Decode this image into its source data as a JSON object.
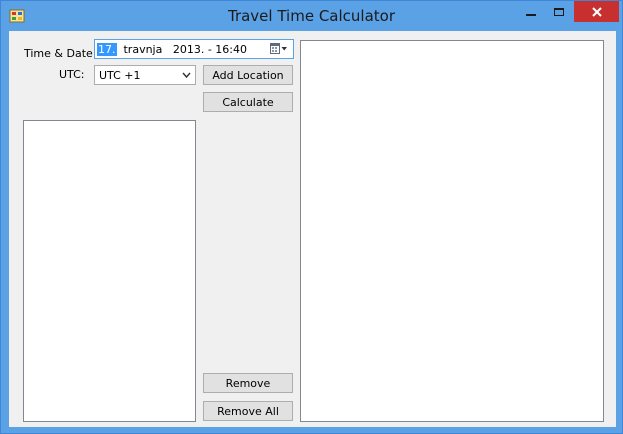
{
  "window": {
    "title": "Travel Time Calculator"
  },
  "form": {
    "datetime_label": "Time & Date:",
    "datetime_day": "17.",
    "datetime_rest": "  travnja   2013. - 16:40",
    "utc_label": "UTC:",
    "utc_selected": "UTC +1"
  },
  "buttons": {
    "add_location": "Add Location",
    "calculate": "Calculate",
    "remove": "Remove",
    "remove_all": "Remove All"
  },
  "colors": {
    "titlebar": "#5aa1e6",
    "close": "#c7302f",
    "client_bg": "#f0f0f0",
    "selection": "#3399ff"
  }
}
